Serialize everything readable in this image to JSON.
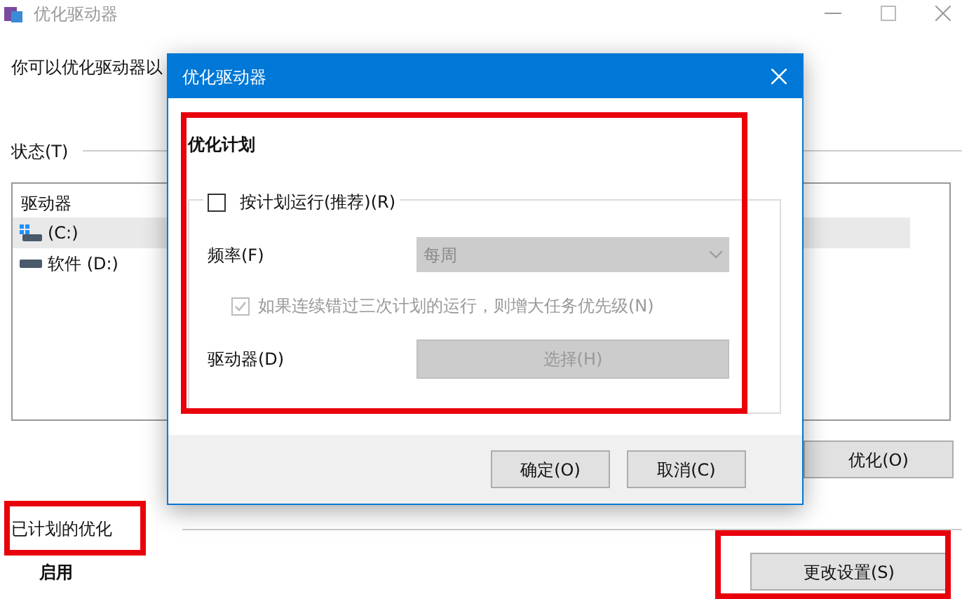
{
  "window": {
    "title": "优化驱动器",
    "description": "你可以优化驱动器以",
    "status_label": "状态(T)",
    "drives_table": {
      "columns": [
        "驱动器"
      ],
      "rows": [
        {
          "name": "(C:)",
          "kind": "system",
          "selected": true
        },
        {
          "name": "软件 (D:)",
          "kind": "drive",
          "selected": false
        }
      ]
    },
    "optimize_button": "优化(O)",
    "scheduled_section": {
      "title": "已计划的优化",
      "status": "启用",
      "change_settings_button": "更改设置(S)"
    }
  },
  "dialog": {
    "title": "优化驱动器",
    "section_title": "优化计划",
    "run_on_schedule": {
      "label": "按计划运行(推荐)(R)",
      "checked": false
    },
    "frequency": {
      "label": "频率(F)",
      "value": "每周",
      "disabled": true
    },
    "increase_priority": {
      "label": "如果连续错过三次计划的运行，则增大任务优先级(N)",
      "checked": true,
      "disabled": true
    },
    "drives": {
      "label": "驱动器(D)",
      "button": "选择(H)",
      "disabled": true
    },
    "buttons": [
      "确定(O)",
      "取消(C)"
    ]
  }
}
